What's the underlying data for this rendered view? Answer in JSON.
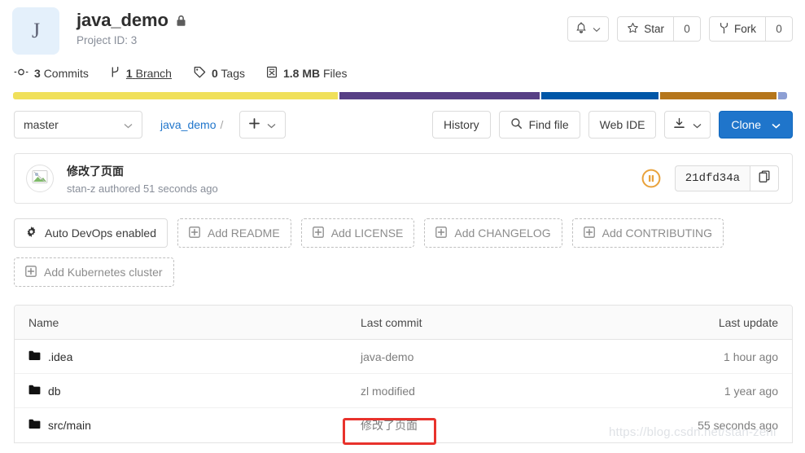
{
  "project": {
    "avatar_letter": "J",
    "name": "java_demo",
    "visibility_icon": "lock-icon",
    "project_id_label": "Project ID: 3"
  },
  "header_actions": {
    "notification_icon": "bell-icon",
    "star_label": "Star",
    "star_count": "0",
    "fork_label": "Fork",
    "fork_count": "0"
  },
  "stats": [
    {
      "icon": "commit-icon",
      "count": "3",
      "label": "Commits",
      "underline": false
    },
    {
      "icon": "branch-icon",
      "count": "1",
      "label": "Branch",
      "underline": true
    },
    {
      "icon": "tag-icon",
      "count": "0",
      "label": "Tags",
      "underline": false
    },
    {
      "icon": "files-icon",
      "count": "1.8 MB",
      "label": "Files",
      "underline": false
    }
  ],
  "language_bar": [
    {
      "name": "yellow-segment",
      "color": "#f0e05a",
      "width": "41.6%"
    },
    {
      "name": "purple-segment",
      "color": "#574085",
      "width": "25.7%"
    },
    {
      "name": "blue-segment",
      "color": "#0057a8",
      "width": "15.1%"
    },
    {
      "name": "orange-segment",
      "color": "#b5761c",
      "width": "14.9%"
    },
    {
      "name": "lightblue-segment",
      "color": "#8d9fd4",
      "width": "1.1%"
    }
  ],
  "toolbar": {
    "branch_value": "master",
    "breadcrumb_project": "java_demo",
    "breadcrumb_separator": "/",
    "plus_label": "+",
    "history_label": "History",
    "find_file_label": "Find file",
    "web_ide_label": "Web IDE",
    "download_icon": "download-icon",
    "clone_label": "Clone"
  },
  "commit": {
    "avatar_icon": "broken-image-icon",
    "message": "修改了页面",
    "author_line": "stan-z authored 51 seconds ago",
    "pipeline_status_icon": "pipeline-pending-icon",
    "sha": "21dfd34a",
    "copy_icon": "copy-icon"
  },
  "add_buttons": [
    {
      "name": "auto-devops-button",
      "icon": "gear-icon",
      "label": "Auto DevOps enabled",
      "style": "solid"
    },
    {
      "name": "add-readme-button",
      "icon": "plus-box-icon",
      "label": "Add README",
      "style": "dashed"
    },
    {
      "name": "add-license-button",
      "icon": "plus-box-icon",
      "label": "Add LICENSE",
      "style": "dashed"
    },
    {
      "name": "add-changelog-button",
      "icon": "plus-box-icon",
      "label": "Add CHANGELOG",
      "style": "dashed"
    },
    {
      "name": "add-contributing-button",
      "icon": "plus-box-icon",
      "label": "Add CONTRIBUTING",
      "style": "dashed"
    },
    {
      "name": "add-kubernetes-cluster-button",
      "icon": "plus-box-icon",
      "label": "Add Kubernetes cluster",
      "style": "dashed"
    }
  ],
  "file_table": {
    "columns": [
      "Name",
      "Last commit",
      "Last update"
    ],
    "rows": [
      {
        "icon": "folder-icon",
        "name": ".idea",
        "last_commit": "java-demo",
        "last_update": "1 hour ago"
      },
      {
        "icon": "folder-icon",
        "name": "db",
        "last_commit": "zl modified",
        "last_update": "1 year ago"
      },
      {
        "icon": "folder-icon",
        "name": "src/main",
        "last_commit": "修改了页面",
        "last_update": "55 seconds ago"
      }
    ]
  },
  "annotation": {
    "name": "red-highlight-box",
    "color": "#e8322c"
  },
  "watermark": {
    "text": "https://blog.csdn.net/stan-zeni"
  }
}
